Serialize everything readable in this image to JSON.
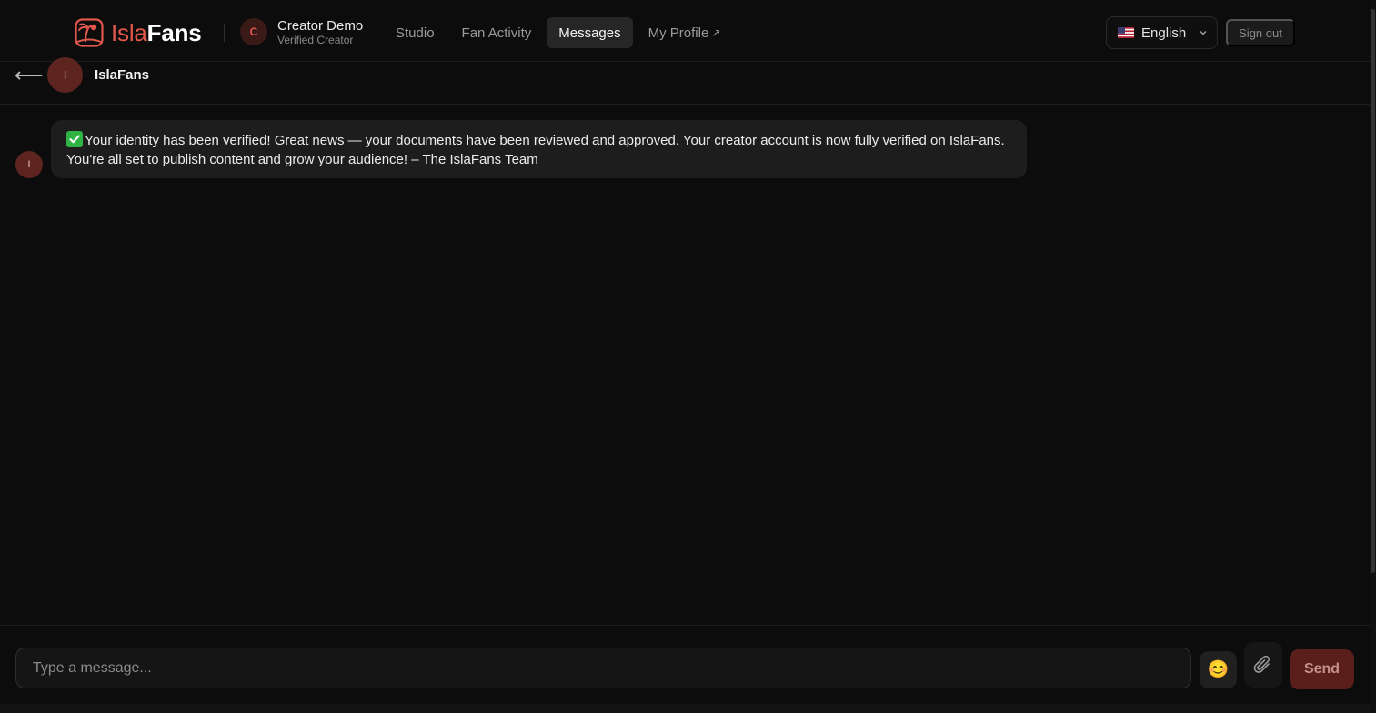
{
  "brand": {
    "name_part1": "Isla",
    "name_part2": "Fans",
    "accent": "#e2574c"
  },
  "creator": {
    "initial": "C",
    "name": "Creator Demo",
    "subtitle": "Verified Creator"
  },
  "nav": {
    "items": [
      {
        "label": "Studio",
        "active": false
      },
      {
        "label": "Fan Activity",
        "active": false
      },
      {
        "label": "Messages",
        "active": true
      },
      {
        "label": "My Profile",
        "external_mark": "↗",
        "active": false
      }
    ]
  },
  "language": {
    "flag": "us-flag-icon",
    "label": "English"
  },
  "signout_label": "Sign out",
  "conversation": {
    "back_glyph": "⟵",
    "avatar_initial": "I",
    "name": "IslaFans"
  },
  "messages": [
    {
      "avatar_initial": "I",
      "prefix_icon": "check-mark-icon",
      "text": "Your identity has been verified! Great news — your documents have been reviewed and approved. Your creator account is now fully verified on IslaFans. You're all set to publish content and grow your audience! – The IslaFans Team"
    }
  ],
  "composer": {
    "placeholder": "Type a message...",
    "value": "",
    "emoji": "😊",
    "send_label": "Send"
  }
}
